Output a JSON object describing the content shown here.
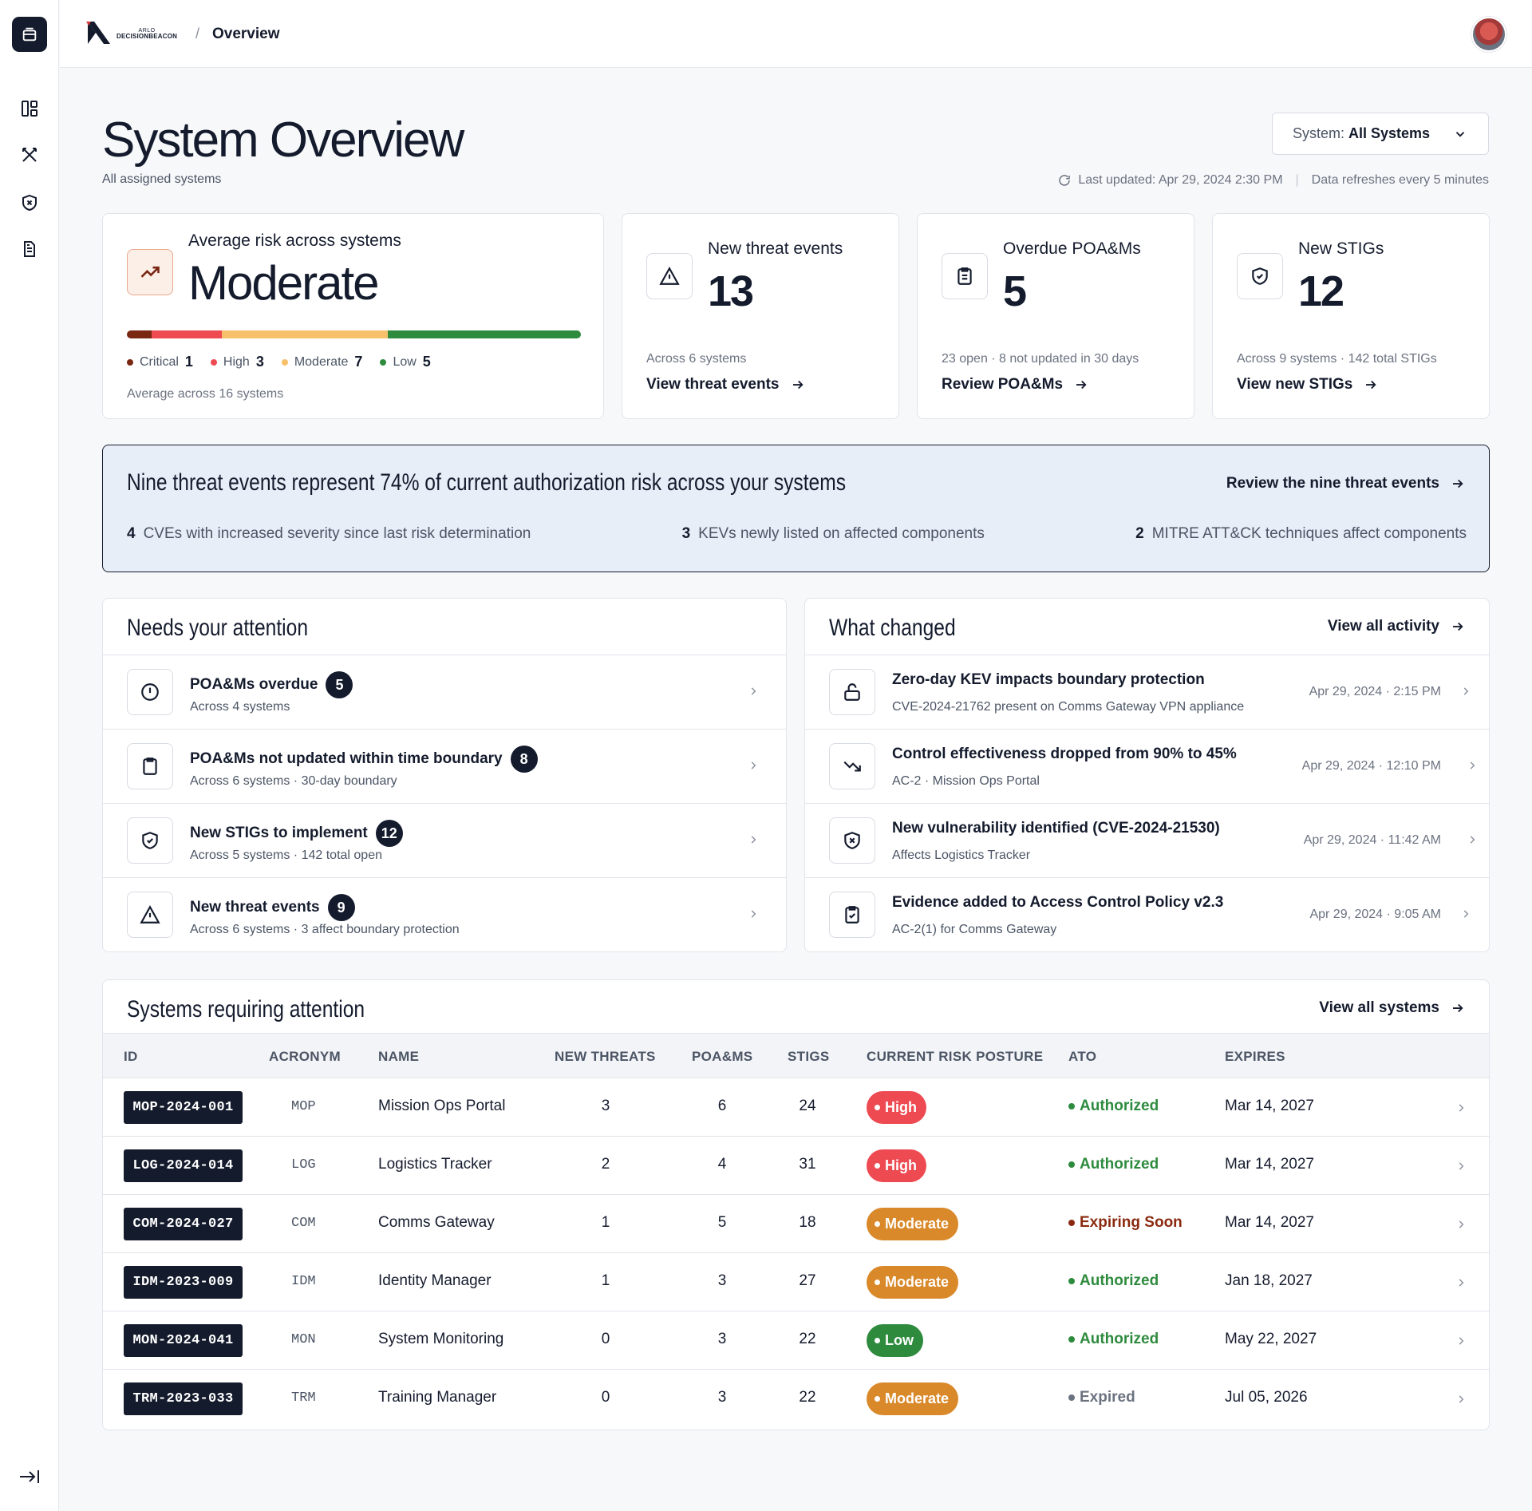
{
  "brand": {
    "small": "ARLO",
    "name": "DECISIONBEACON"
  },
  "breadcrumb": {
    "separator": "/",
    "current": "Overview"
  },
  "header": {
    "title": "System Overview",
    "subtitle": "All assigned systems",
    "system_select_prefix": "System:",
    "system_select_value": "All Systems",
    "last_updated": "Last updated: Apr 29, 2024 2:30 PM",
    "refresh_note": "Data refreshes every 5 minutes",
    "separator": "|"
  },
  "risk_card": {
    "label": "Average risk across systems",
    "value": "Moderate",
    "segments": [
      {
        "name": "Critical",
        "count": 1,
        "color": "#7a2712",
        "fraction": 0.055
      },
      {
        "name": "High",
        "count": 3,
        "color": "#ee4a52",
        "fraction": 0.155
      },
      {
        "name": "Moderate",
        "count": 7,
        "color": "#f7c06b",
        "fraction": 0.365
      },
      {
        "name": "Low",
        "count": 5,
        "color": "#2e8b3e",
        "fraction": 0.425
      }
    ],
    "footer": "Average across 16 systems"
  },
  "stats": [
    {
      "label": "New threat events",
      "value": "13",
      "sub": "Across 6 systems",
      "link": "View threat events",
      "icon": "warning-triangle-icon"
    },
    {
      "label": "Overdue POA&Ms",
      "value": "5",
      "sub": "23 open · 8 not updated in 30 days",
      "link": "Review POA&Ms",
      "icon": "clipboard-list-icon"
    },
    {
      "label": "New STIGs",
      "value": "12",
      "sub": "Across 9 systems · 142 total STIGs",
      "link": "View new STIGs",
      "icon": "shield-check-icon"
    }
  ],
  "insight": {
    "title": "Nine threat events represent 74% of current authorization risk across your systems",
    "link": "Review the nine threat events",
    "facts": [
      {
        "count": "4",
        "text": "CVEs with increased severity since last risk determination"
      },
      {
        "count": "3",
        "text": "KEVs newly listed on affected components"
      },
      {
        "count": "2",
        "text": "MITRE ATT&CK techniques affect components"
      }
    ]
  },
  "attention": {
    "title": "Needs your attention",
    "items": [
      {
        "title": "POA&Ms overdue",
        "count": "5",
        "sub": "Across 4 systems",
        "icon": "alert-circle-icon"
      },
      {
        "title": "POA&Ms not updated within time boundary",
        "count": "8",
        "sub": "Across 6 systems · 30-day boundary",
        "icon": "clipboard-icon"
      },
      {
        "title": "New STIGs to implement",
        "count": "12",
        "sub": "Across 5 systems · 142 total open",
        "icon": "shield-check-icon"
      },
      {
        "title": "New threat events",
        "count": "9",
        "sub": "Across 6 systems · 3 affect boundary protection",
        "icon": "warning-triangle-icon"
      }
    ]
  },
  "changes": {
    "title": "What changed",
    "link": "View all activity",
    "items": [
      {
        "title": "Zero-day KEV impacts boundary protection",
        "sub": "CVE-2024-21762 present on Comms Gateway VPN appliance",
        "time": "Apr 29, 2024 · 2:15 PM",
        "icon": "unlock-icon"
      },
      {
        "title": "Control effectiveness dropped from 90% to 45%",
        "sub": "AC-2 · Mission Ops Portal",
        "time": "Apr 29, 2024 · 12:10 PM",
        "icon": "trend-down-icon"
      },
      {
        "title": "New vulnerability identified (CVE-2024-21530)",
        "sub": "Affects Logistics Tracker",
        "time": "Apr 29, 2024 · 11:42 AM",
        "icon": "shield-x-icon"
      },
      {
        "title": "Evidence added to Access Control Policy v2.3",
        "sub": "AC-2(1) for Comms Gateway",
        "time": "Apr 29, 2024 · 9:05 AM",
        "icon": "clipboard-check-icon"
      }
    ]
  },
  "systems": {
    "title": "Systems requiring attention",
    "link": "View all systems",
    "columns": [
      "ID",
      "ACRONYM",
      "NAME",
      "NEW THREATS",
      "POA&MS",
      "STIGS",
      "CURRENT RISK POSTURE",
      "ATO",
      "EXPIRES"
    ],
    "rows": [
      {
        "id": "MOP-2024-001",
        "acronym": "MOP",
        "name": "Mission Ops Portal",
        "threats": "3",
        "poams": "6",
        "stigs": "24",
        "risk": "High",
        "risk_color": "#ee4a52",
        "ato": "Authorized",
        "ato_color": "#2e8b3e",
        "expires": "Mar 14, 2027"
      },
      {
        "id": "LOG-2024-014",
        "acronym": "LOG",
        "name": "Logistics Tracker",
        "threats": "2",
        "poams": "4",
        "stigs": "31",
        "risk": "High",
        "risk_color": "#ee4a52",
        "ato": "Authorized",
        "ato_color": "#2e8b3e",
        "expires": "Mar 14, 2027"
      },
      {
        "id": "COM-2024-027",
        "acronym": "COM",
        "name": "Comms Gateway",
        "threats": "1",
        "poams": "5",
        "stigs": "18",
        "risk": "Moderate",
        "risk_color": "#d9892a",
        "ato": "Expiring Soon",
        "ato_color": "#8a2a10",
        "expires": "Mar 14, 2027"
      },
      {
        "id": "IDM-2023-009",
        "acronym": "IDM",
        "name": "Identity Manager",
        "threats": "1",
        "poams": "3",
        "stigs": "27",
        "risk": "Moderate",
        "risk_color": "#d9892a",
        "ato": "Authorized",
        "ato_color": "#2e8b3e",
        "expires": "Jan 18, 2027"
      },
      {
        "id": "MON-2024-041",
        "acronym": "MON",
        "name": "System Monitoring",
        "threats": "0",
        "poams": "3",
        "stigs": "22",
        "risk": "Low",
        "risk_color": "#2e8b3e",
        "ato": "Authorized",
        "ato_color": "#2e8b3e",
        "expires": "May 22, 2027"
      },
      {
        "id": "TRM-2023-033",
        "acronym": "TRM",
        "name": "Training Manager",
        "threats": "0",
        "poams": "3",
        "stigs": "22",
        "risk": "Moderate",
        "risk_color": "#d9892a",
        "ato": "Expired",
        "ato_color": "#6b7280",
        "expires": "Jul 05, 2026"
      }
    ]
  }
}
